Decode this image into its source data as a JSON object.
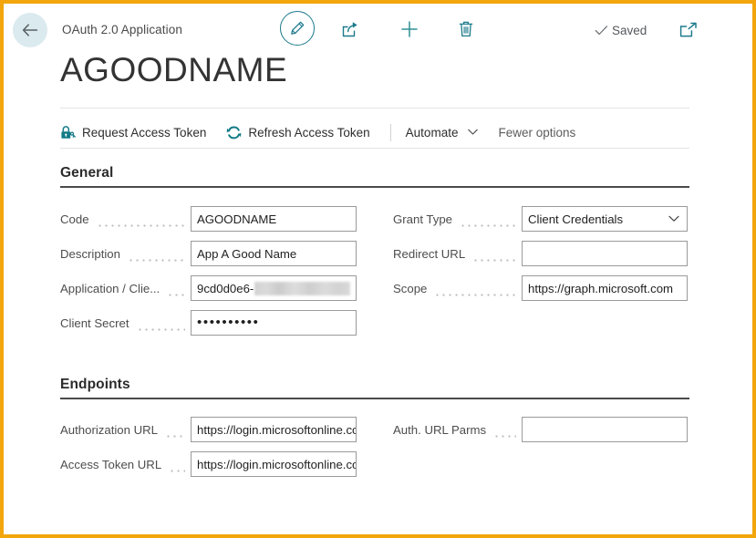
{
  "window": {
    "border_color": "#f2a50c",
    "accent_color": "#1c7a8c"
  },
  "topbar": {
    "back_label": "Back",
    "breadcrumb": "OAuth 2.0 Application",
    "edit_label": "Edit",
    "share_label": "Share",
    "new_label": "New",
    "delete_label": "Delete",
    "saved_label": "Saved",
    "open_label": "Open in new window"
  },
  "page_title": "AGOODNAME",
  "action_bar": {
    "items": [
      {
        "label": "Request Access Token",
        "icon": "lock-key-icon"
      },
      {
        "label": "Refresh Access Token",
        "icon": "refresh-icon"
      },
      {
        "label": "Automate",
        "icon": "chevron-down-icon"
      },
      {
        "label": "Fewer options",
        "icon": ""
      }
    ]
  },
  "general": {
    "heading": "General",
    "left": [
      {
        "label": "Code",
        "value": "AGOODNAME",
        "placeholder": "",
        "type": "text"
      },
      {
        "label": "Description",
        "value": "App A Good Name",
        "placeholder": "",
        "type": "text"
      },
      {
        "label": "Application / Clie...",
        "value": "9cd0d0e6-",
        "placeholder": "",
        "type": "redacted"
      },
      {
        "label": "Client Secret",
        "value": "••••••••••",
        "placeholder": "",
        "type": "password"
      }
    ],
    "right": [
      {
        "label": "Grant Type",
        "value": "Client Credentials",
        "placeholder": "",
        "type": "select"
      },
      {
        "label": "Redirect URL",
        "value": "",
        "placeholder": "",
        "type": "text"
      },
      {
        "label": "Scope",
        "value": "https://graph.microsoft.com",
        "placeholder": "",
        "type": "text"
      }
    ]
  },
  "endpoints": {
    "heading": "Endpoints",
    "left": [
      {
        "label": "Authorization URL",
        "value": "https://login.microsoftonline.com",
        "placeholder": "",
        "type": "text"
      },
      {
        "label": "Access Token URL",
        "value": "https://login.microsoftonline.com",
        "placeholder": "",
        "type": "text"
      }
    ],
    "right": [
      {
        "label": "Auth. URL Parms",
        "value": "",
        "placeholder": "",
        "type": "text"
      }
    ]
  }
}
